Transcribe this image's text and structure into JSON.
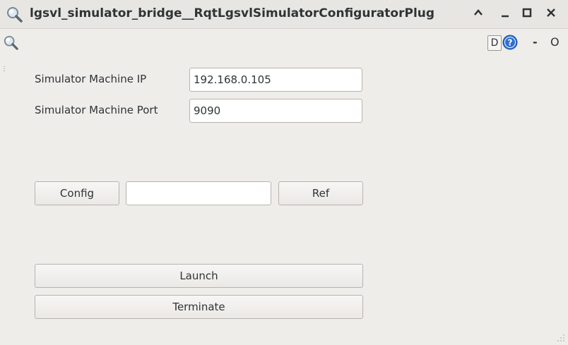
{
  "window": {
    "title": "lgsvl_simulator_bridge__RqtLgsvlSimulatorConfiguratorPlug",
    "controls": {
      "shade": "^",
      "minimize": "_",
      "maximize": "□",
      "close": "×"
    }
  },
  "plugin_bar": {
    "d_label": "D",
    "dash_label": "-",
    "o_label": "O"
  },
  "form": {
    "ip_label": "Simulator Machine IP",
    "ip_value": "192.168.0.105",
    "port_label": "Simulator Machine Port",
    "port_value": "9090"
  },
  "config_row": {
    "config_label": "Config",
    "path_value": "",
    "ref_label": "Ref"
  },
  "actions": {
    "launch_label": "Launch",
    "terminate_label": "Terminate"
  },
  "icons": {
    "title": "magnifier-icon",
    "plugin": "magnifier-icon",
    "help": "help-icon",
    "resize": "resize-grip-icon"
  },
  "colors": {
    "background": "#efedea",
    "help_blue": "#2f6fd0"
  }
}
